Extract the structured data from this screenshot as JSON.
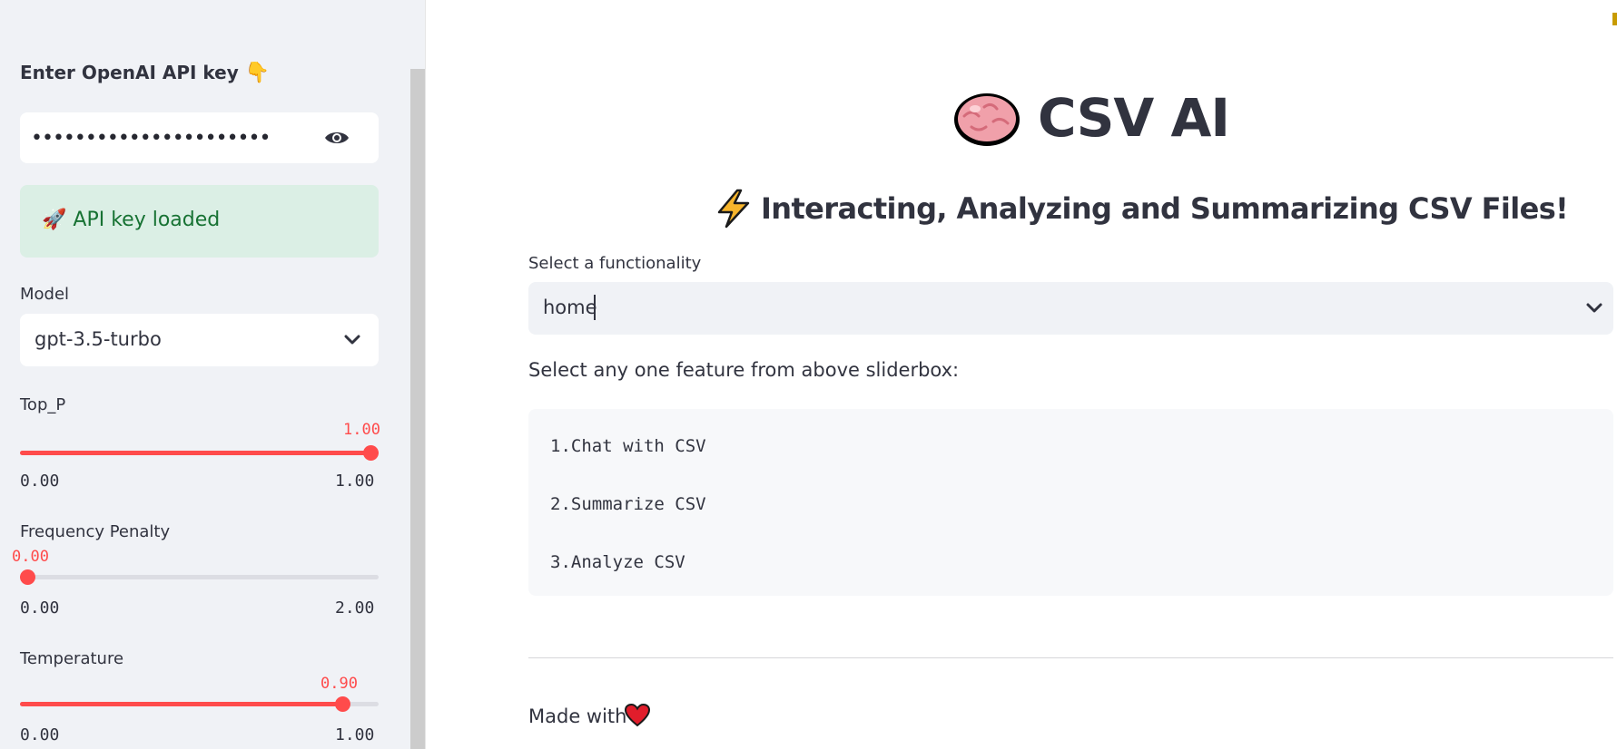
{
  "sidebar": {
    "api_key": {
      "label": "Enter OpenAI API key",
      "label_emoji": "👇",
      "masked_value": "••••••••••••••••••••••",
      "toggle_icon": "eye-icon"
    },
    "status": {
      "emoji": "🚀",
      "text": "API key loaded",
      "color": "#177233",
      "background": "#dbefe5"
    },
    "model": {
      "label": "Model",
      "selected": "gpt-3.5-turbo"
    },
    "sliders": [
      {
        "label": "Top_P",
        "value": "1.00",
        "min": "0.00",
        "max": "1.00",
        "fraction": 1.0
      },
      {
        "label": "Frequency Penalty",
        "value": "0.00",
        "min": "0.00",
        "max": "2.00",
        "fraction": 0.0
      },
      {
        "label": "Temperature",
        "value": "0.90",
        "min": "0.00",
        "max": "1.00",
        "fraction": 0.9
      }
    ],
    "accent_color": "#ff4b4b"
  },
  "main": {
    "title_emoji": "🧠",
    "title": "CSV AI",
    "subtitle_emoji": "⚡",
    "subtitle": "Interacting, Analyzing and Summarizing CSV Files!",
    "functionality": {
      "label": "Select a functionality",
      "selected": "home"
    },
    "instructions": "Select any one feature from above sliderbox:",
    "features": [
      "1.Chat with CSV",
      "2.Summarize CSV",
      "3.Analyze CSV"
    ],
    "footer": {
      "text": "Made with",
      "emoji": "❤️"
    }
  }
}
